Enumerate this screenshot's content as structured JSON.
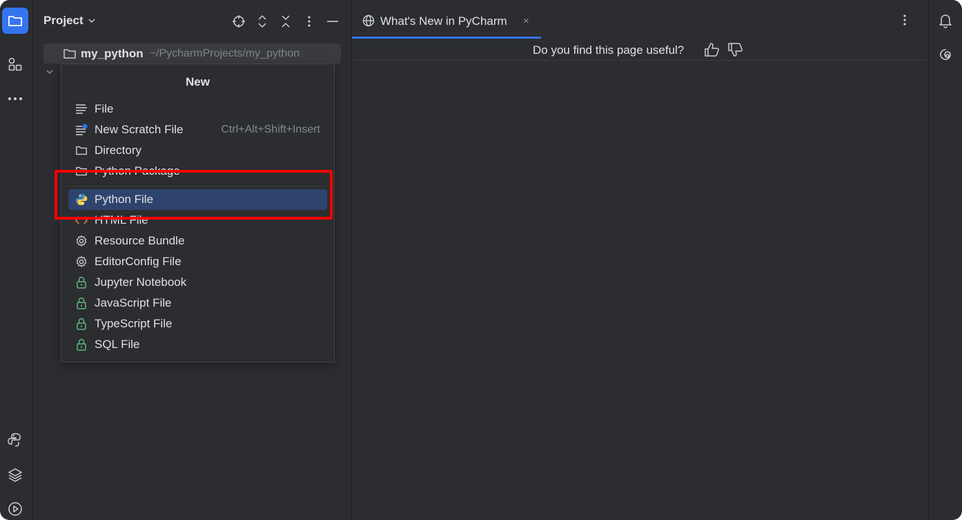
{
  "project_panel": {
    "title": "Project",
    "root": {
      "name": "my_python",
      "path": "~/PycharmProjects/my_python"
    }
  },
  "new_menu": {
    "title": "New",
    "items": [
      {
        "label": "File",
        "icon": "text-file-icon",
        "shortcut": ""
      },
      {
        "label": "New Scratch File",
        "icon": "scratch-file-icon",
        "shortcut": "Ctrl+Alt+Shift+Insert"
      },
      {
        "label": "Directory",
        "icon": "folder-icon",
        "shortcut": ""
      },
      {
        "label": "Python Package",
        "icon": "package-folder-icon",
        "shortcut": ""
      },
      {
        "label": "Python File",
        "icon": "python-icon",
        "shortcut": "",
        "selected": true
      },
      {
        "label": "HTML File",
        "icon": "html-icon",
        "shortcut": ""
      },
      {
        "label": "Resource Bundle",
        "icon": "gear-icon",
        "shortcut": ""
      },
      {
        "label": "EditorConfig File",
        "icon": "gear-icon",
        "shortcut": ""
      },
      {
        "label": "Jupyter Notebook",
        "icon": "lock-icon",
        "shortcut": ""
      },
      {
        "label": "JavaScript File",
        "icon": "lock-icon",
        "shortcut": ""
      },
      {
        "label": "TypeScript File",
        "icon": "lock-icon",
        "shortcut": ""
      },
      {
        "label": "SQL File",
        "icon": "lock-icon",
        "shortcut": ""
      }
    ]
  },
  "editor": {
    "tab": {
      "label": "What's New in PyCharm",
      "close": "×"
    },
    "banner": {
      "question": "Do you find this page useful?"
    }
  },
  "colors": {
    "accent": "#3574f0",
    "selection": "#2e436e",
    "highlight_box": "#ff0000",
    "lock_green": "#5fb87f",
    "background": "#2b2d30"
  }
}
